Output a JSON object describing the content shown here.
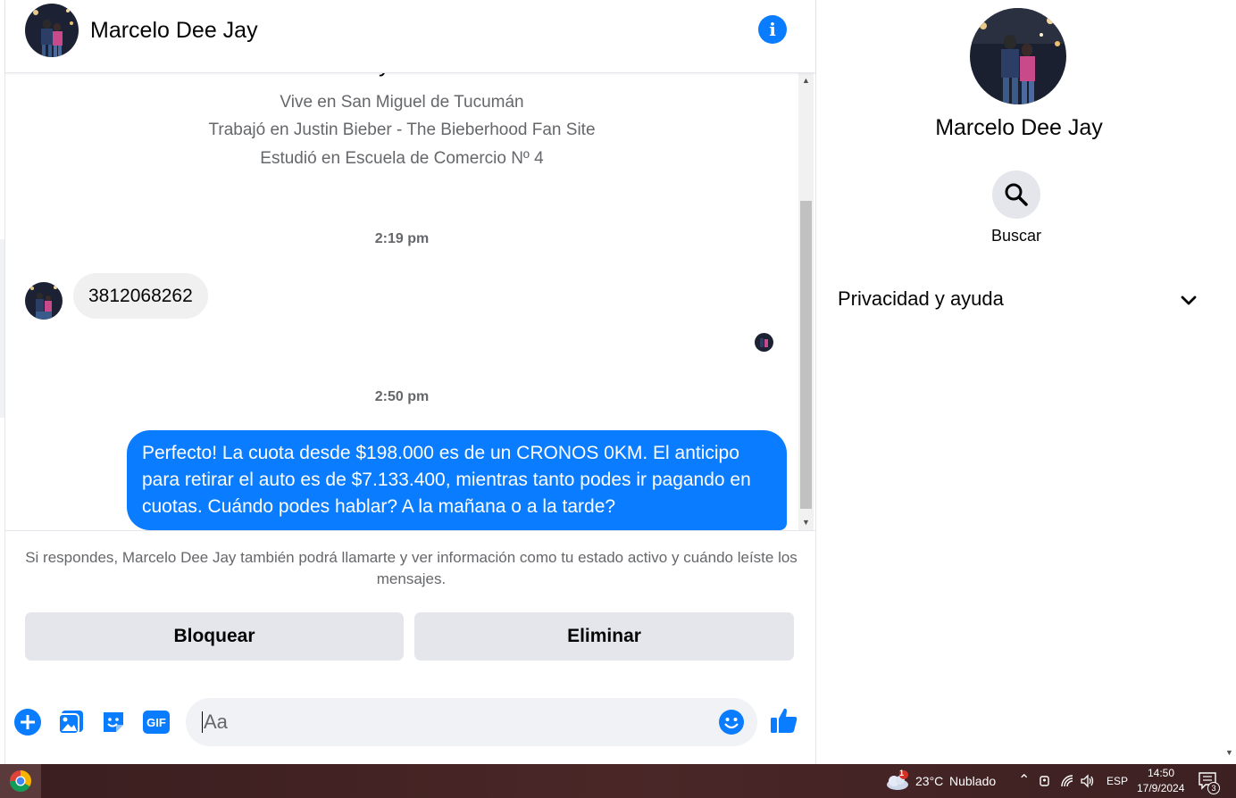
{
  "header": {
    "contact_name": "Marcelo Dee Jay",
    "info_icon": "info-icon"
  },
  "profile": {
    "lines": [
      "Vive en San Miguel de Tucumán",
      "Trabajó en Justin Bieber - The Bieberhood Fan Site",
      "Estudió en Escuela de Comercio Nº 4"
    ]
  },
  "messages": {
    "time_1": "2:19 pm",
    "incoming_text": "3812068262",
    "time_2": "2:50 pm",
    "outgoing_text": "Perfecto! La cuota desde $198.000 es de un CRONOS 0KM. El anticipo para retirar el auto es de $7.133.400, mientras tanto podes ir pagando en cuotas. Cuándo podes hablar? A la mañana o a la tarde?"
  },
  "notice": "Si respondes, Marcelo Dee Jay también podrá llamarte y ver información como tu estado activo y cuándo leíste los mensajes.",
  "actions": {
    "block_label": "Bloquear",
    "delete_label": "Eliminar"
  },
  "composer": {
    "placeholder": "Aa",
    "icons": [
      "plus-icon",
      "photo-icon",
      "sticker-icon",
      "gif-icon",
      "emoji-icon",
      "like-icon"
    ],
    "gif_label": "GIF"
  },
  "side_panel": {
    "name": "Marcelo Dee Jay",
    "search_label": "Buscar",
    "privacy_label": "Privacidad y ayuda"
  },
  "taskbar": {
    "weather_temp": "23°C",
    "weather_desc": "Nublado",
    "weather_badge": "1",
    "language": "ESP",
    "time": "14:50",
    "date": "17/9/2024",
    "notification_count": "3"
  },
  "colors": {
    "accent": "#0a7cff",
    "bubble_in": "#f0f0f0",
    "button_bg": "#e4e6eb",
    "secondary_text": "#65676b"
  }
}
